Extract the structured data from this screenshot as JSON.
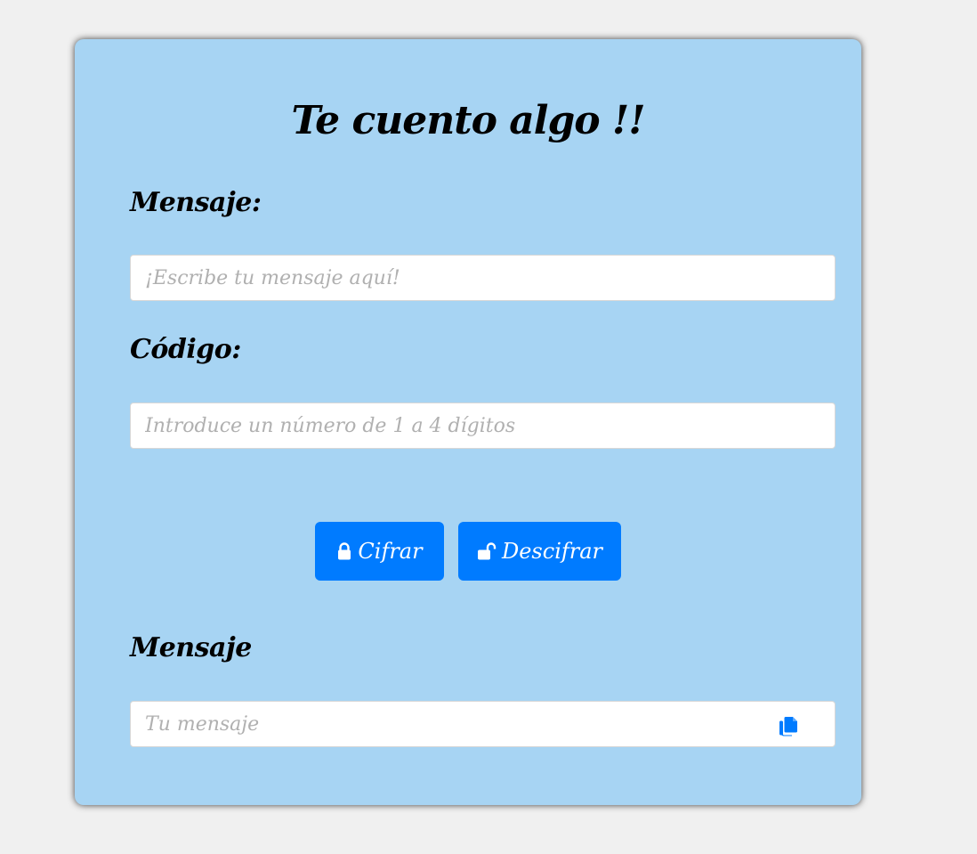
{
  "page": {
    "title": "Te cuento algo !!"
  },
  "form": {
    "message_label": "Mensaje:",
    "message_placeholder": "¡Escribe tu mensaje aquí!",
    "code_label": "Código:",
    "code_placeholder": "Introduce un número de 1 a 4 dígitos",
    "encrypt_label": "Cifrar",
    "decrypt_label": "Descifrar",
    "result_label": "Mensaje",
    "result_placeholder": "Tu mensaje"
  },
  "icons": {
    "encrypt": "lock-icon",
    "decrypt": "unlock-icon",
    "copy": "copy-icon"
  },
  "colors": {
    "background": "#f0f0f0",
    "card": "#a7d4f3",
    "button": "#007bff",
    "copy_icon": "#007bff"
  }
}
